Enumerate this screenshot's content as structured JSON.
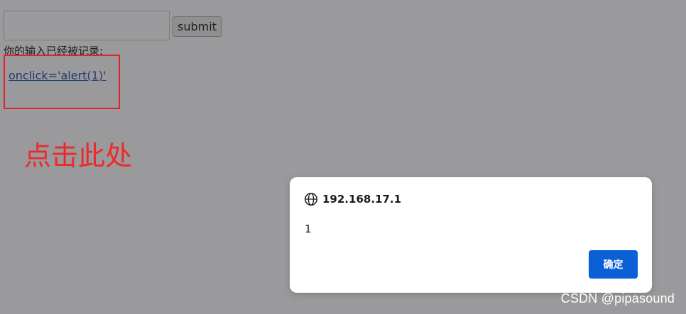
{
  "form": {
    "input_value": "",
    "submit_label": "submit"
  },
  "log": {
    "label": "你的输入已经被记录:",
    "link_text": "onclick='alert(1)'"
  },
  "annotation": {
    "text": "点击此处",
    "color": "#ec2a2a",
    "box_color": "#e0242b"
  },
  "dialog": {
    "icon": "globe-icon",
    "origin": "192.168.17.1",
    "message": "1",
    "ok_label": "确定",
    "ok_color": "#0b60d6"
  },
  "watermark": {
    "text": "CSDN @pipasound"
  }
}
